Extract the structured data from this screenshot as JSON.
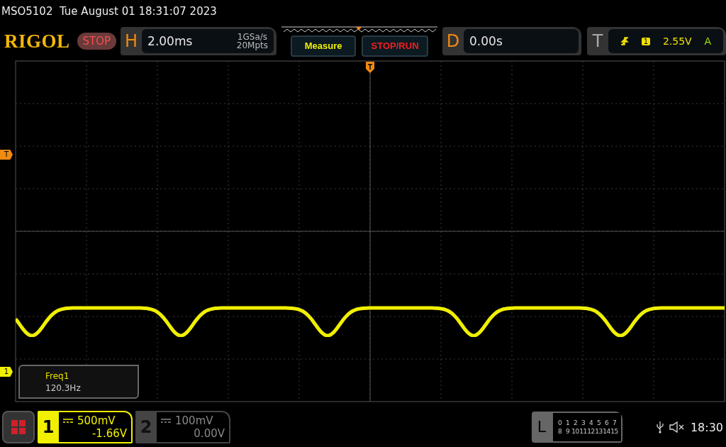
{
  "title_bar": {
    "model": "MSO5102",
    "datetime": "Tue August 01 18:31:07 2023"
  },
  "header": {
    "brand": "RIGOL",
    "run_state": "STOP",
    "horizontal": {
      "letter": "H",
      "timebase": "2.00ms",
      "sample_rate": "1GSa/s",
      "memory_depth": "20Mpts"
    },
    "measure_button": "Measure",
    "stop_run_button": "STOP/RUN",
    "delay": {
      "letter": "D",
      "value": "0.00s"
    },
    "trigger": {
      "letter": "T",
      "source": "1",
      "level": "2.55V",
      "mode": "A"
    }
  },
  "markers": {
    "trigger_level": "T",
    "channel_1": "1"
  },
  "measurement": {
    "name": "Freq1",
    "value": "120.3Hz"
  },
  "channels": [
    {
      "number": "1",
      "scale": "500mV",
      "offset": "-1.66V",
      "selected": true
    },
    {
      "number": "2",
      "scale": "100mV",
      "offset": "0.00V",
      "selected": false
    }
  ],
  "logic": {
    "letter": "L",
    "rows": [
      [
        "0",
        "1",
        "2",
        "3",
        "4",
        "5",
        "6",
        "7"
      ],
      [
        "8",
        "9",
        "10",
        "11",
        "12",
        "13",
        "14",
        "15"
      ]
    ]
  },
  "status": {
    "time": "18:30"
  }
}
